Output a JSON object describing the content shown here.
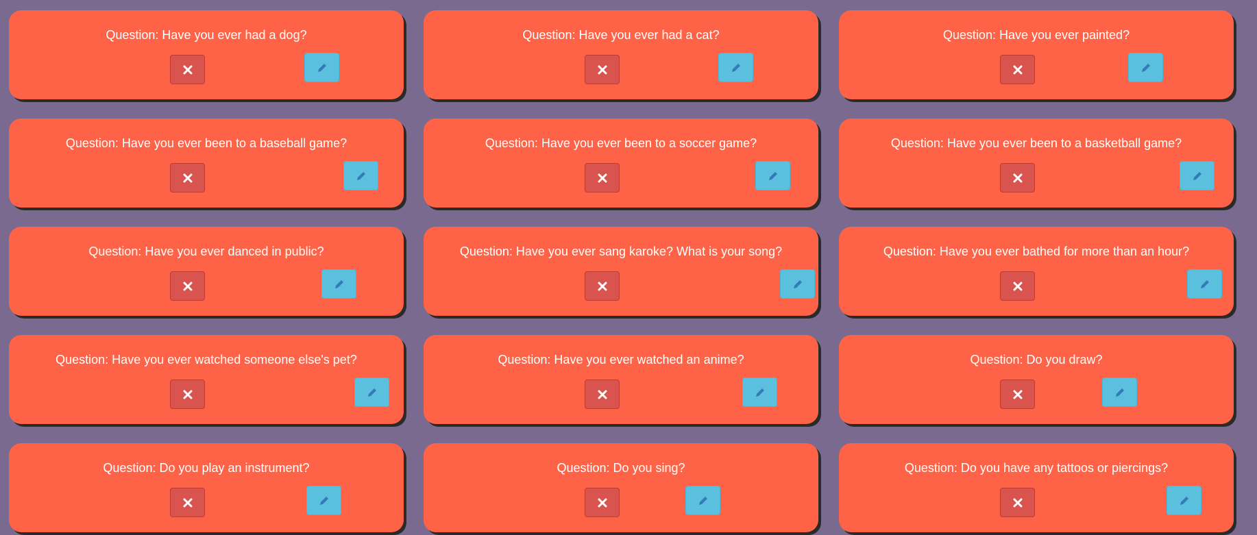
{
  "colors": {
    "page_background": "#7a6a90",
    "card_background": "#ff6347",
    "delete_button": "#d9534f",
    "edit_button": "#5bc0de",
    "pencil_icon": "#337ab7"
  },
  "icons": {
    "delete": "close-icon",
    "edit": "pencil-icon"
  },
  "cards": [
    {
      "question": "Question: Have you ever had a dog?"
    },
    {
      "question": "Question: Have you ever had a cat?"
    },
    {
      "question": "Question: Have you ever painted?"
    },
    {
      "question": "Question: Have you ever been to a baseball game?"
    },
    {
      "question": "Question: Have you ever been to a soccer game?"
    },
    {
      "question": "Question: Have you ever been to a basketball game?"
    },
    {
      "question": "Question: Have you ever danced in public?"
    },
    {
      "question": "Question: Have you ever sang karoke? What is your song?"
    },
    {
      "question": "Question: Have you ever bathed for more than an hour?"
    },
    {
      "question": "Question: Have you ever watched someone else's pet?"
    },
    {
      "question": "Question: Have you ever watched an anime?"
    },
    {
      "question": "Question: Do you draw?"
    },
    {
      "question": "Question: Do you play an instrument?"
    },
    {
      "question": "Question: Do you sing?"
    },
    {
      "question": "Question: Do you have any tattoos or piercings?"
    }
  ]
}
